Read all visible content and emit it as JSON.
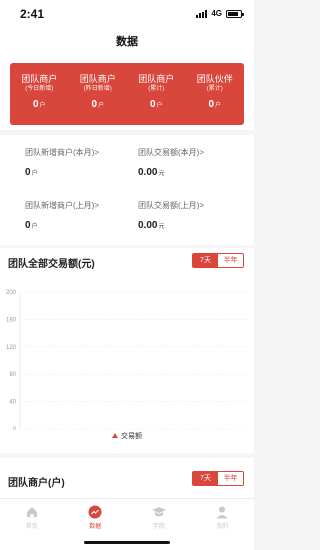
{
  "status_bar": {
    "time": "2:41",
    "network": "4G"
  },
  "header": {
    "title": "数据"
  },
  "summary_cards": [
    {
      "label": "团队商户",
      "sub": "(今日新增)",
      "value": "0",
      "unit": "户"
    },
    {
      "label": "团队商户",
      "sub": "(昨日新增)",
      "value": "0",
      "unit": "户"
    },
    {
      "label": "团队商户",
      "sub": "(累计)",
      "value": "0",
      "unit": "户"
    },
    {
      "label": "团队伙伴",
      "sub": "(累计)",
      "value": "0",
      "unit": "户"
    }
  ],
  "stats": [
    {
      "label": "团队新增商户(本月)>",
      "value": "0",
      "unit": "户"
    },
    {
      "label": "团队交易额(本月)>",
      "value": "0.00",
      "unit": "元"
    },
    {
      "label": "团队新增商户(上月)>",
      "value": "0",
      "unit": "户"
    },
    {
      "label": "团队交易额(上月)>",
      "value": "0.00",
      "unit": "元"
    }
  ],
  "transaction_section": {
    "title": "团队全部交易额(元)",
    "toggle": [
      "7天",
      "半年"
    ],
    "active_index": 0
  },
  "chart_data": {
    "type": "line",
    "yticks": [
      "200",
      "160",
      "120",
      "80",
      "40",
      "0"
    ],
    "ylim": [
      0,
      200
    ],
    "series": [
      {
        "name": "交易额",
        "values": []
      }
    ],
    "legend_placement": "bottom",
    "grid": true,
    "color": "#d9463b"
  },
  "merchant_section": {
    "title": "团队商户(户)",
    "toggle": [
      "7天",
      "半年"
    ],
    "active_index": 0
  },
  "tabbar": [
    {
      "label": "首页",
      "icon": "home-icon"
    },
    {
      "label": "数据",
      "icon": "trend-icon"
    },
    {
      "label": "学院",
      "icon": "graduation-cap-icon"
    },
    {
      "label": "我的",
      "icon": "user-icon"
    }
  ],
  "colors": {
    "accent": "#d9463b"
  }
}
